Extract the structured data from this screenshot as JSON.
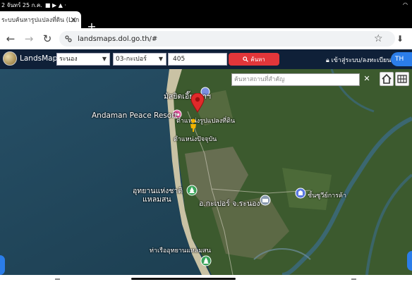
{
  "status_bar": {
    "time_date": "2 จันทร์ 25 ก.ค."
  },
  "browser": {
    "tab_title": "ระบบค้นหารูปแปลงที่ดิน (Lan",
    "url": "landsmaps.dol.go.th/#"
  },
  "app": {
    "brand": "LandsMaps",
    "province": "ระนอง",
    "district": "03-กะเปอร์",
    "parcel_number": "405",
    "search_label": "ค้นหา",
    "login_label": "เข้าสู่ระบบ/ลงทะเบียน",
    "lang": "TH"
  },
  "map": {
    "place_search_placeholder": "ค้นหาสถานที่สำคัญ",
    "labels": {
      "mosque": "มัสยิดเอี๊ยะซาฯ",
      "resort": "Andaman Peace Resort",
      "parcel_location": "ตำแหน่งรูปแปลงที่ดิน",
      "user_location": "ตำแหน่งปัจจุบัน",
      "national_park": "อุทยานแห่งชาติ\nแหลมสน",
      "district_office": "อ.กะเปอร์ จ.ระนอง",
      "plantation": "ชั้นซูวีย์การค้า",
      "pier": "ท่าเรืออุทยานแหลมสน"
    }
  },
  "colors": {
    "header_bg": "#0f2038",
    "search_button": "#e2363a",
    "accent": "#2b7de9"
  }
}
